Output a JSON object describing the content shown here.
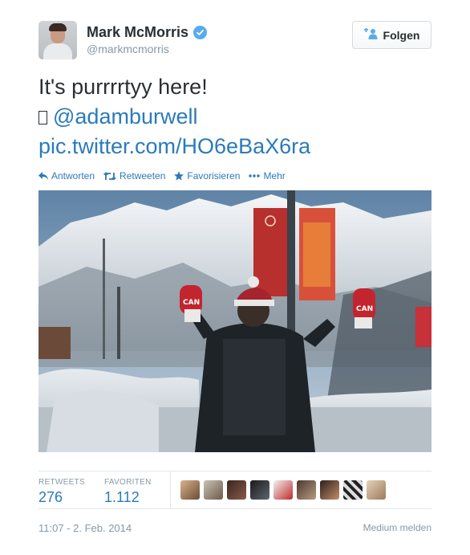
{
  "user": {
    "name": "Mark McMorris",
    "handle": "@markmcmorris",
    "avatar_icon": "profile-photo",
    "verified_icon": "verified-badge-icon"
  },
  "follow_button": {
    "label": "Folgen",
    "icon": "follow-person-plus-icon"
  },
  "tweet": {
    "line1": "It's purrrrtyy here!",
    "mention": "@adamburwell",
    "link": "pic.twitter.com/HO6eBaX6ra"
  },
  "actions": {
    "reply": "Antworten",
    "retweet": "Retweeten",
    "favorite": "Favorisieren",
    "more": "Mehr"
  },
  "stats": {
    "retweets_label": "RETWEETS",
    "retweets_count": "276",
    "favorites_label": "FAVORITEN",
    "favorites_count": "1.112"
  },
  "footer": {
    "timestamp": "11:07 - 2. Feb. 2014",
    "report": "Medium melden"
  },
  "colors": {
    "link": "#2b7bb9",
    "verified": "#55acee",
    "muted": "#8899a6"
  }
}
